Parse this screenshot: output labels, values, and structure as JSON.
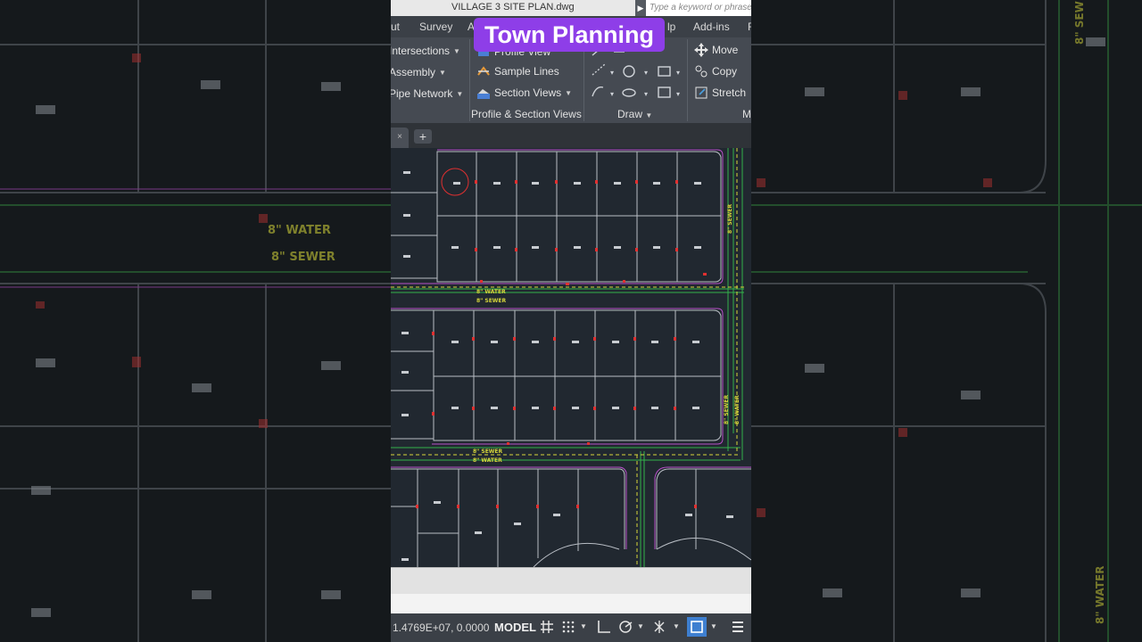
{
  "window": {
    "file_title": "VILLAGE 3 SITE PLAN.dwg",
    "search_placeholder": "Type a keyword or phrase"
  },
  "ribbon_tabs": [
    "ut",
    "Survey",
    "A",
    "lp",
    "Add-ins",
    "F"
  ],
  "overlay_label": "Town Planning",
  "ribbon": {
    "create_design": [
      "Intersections",
      "Assembly",
      "Pipe Network"
    ],
    "profile_section": {
      "items": [
        "Profile View",
        "Sample Lines",
        "Section Views"
      ],
      "panel_label": "Profile & Section Views"
    },
    "draw": {
      "panel_label": "Draw"
    },
    "modify": {
      "items": [
        "Move",
        "Copy",
        "Stretch"
      ],
      "panel_label": "M"
    }
  },
  "doc_tabs": {
    "plus": "+"
  },
  "drawing": {
    "labels": {
      "water_top": "8\" WATER",
      "sewer_top": "8\" SEWER",
      "sewer_mid": "8\" SEWER",
      "water_mid": "8\" WATER",
      "vert_sewer": "8\" SEWER",
      "vert_water": "8\" WATER"
    }
  },
  "background": {
    "water": "8\" WATER",
    "sewer": "8\" SEWER"
  },
  "status_bar": {
    "coords": "1.4769E+07, 0.0000",
    "model": "MODEL"
  },
  "colors": {
    "accent_overlay": "#8e3ee8",
    "canvas": "#212830",
    "lot_line": "#b9bec5",
    "road_green": "#33b24a",
    "magenta": "#b84fc8",
    "pipe_yellow": "#d6d63a",
    "red_marker": "#e03030"
  }
}
